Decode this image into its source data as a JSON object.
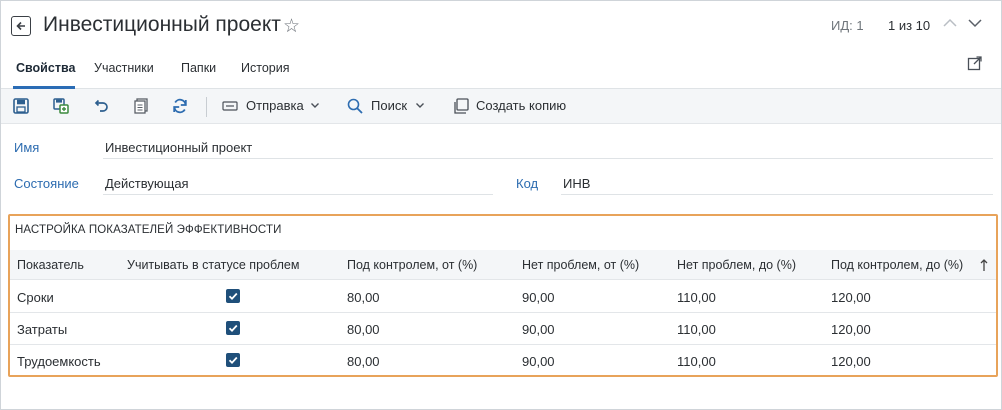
{
  "header": {
    "title": "Инвестиционный проект",
    "id_label": "ИД: 1",
    "pager": "1 из 10"
  },
  "tabs": [
    {
      "label": "Свойства",
      "active": true
    },
    {
      "label": "Участники",
      "active": false
    },
    {
      "label": "Папки",
      "active": false
    },
    {
      "label": "История",
      "active": false
    }
  ],
  "toolbar": {
    "send_label": "Отправка",
    "search_label": "Поиск",
    "copy_label": "Создать копию"
  },
  "fields": {
    "name_label": "Имя",
    "name_value": "Инвестиционный проект",
    "state_label": "Состояние",
    "state_value": "Действующая",
    "code_label": "Код",
    "code_value": "ИНВ"
  },
  "section": {
    "title": "НАСТРОЙКА ПОКАЗАТЕЛЕЙ ЭФФЕКТИВНОСТИ",
    "columns": [
      "Показатель",
      "Учитывать в статусе проблем",
      "Под контролем, от (%)",
      "Нет проблем, от (%)",
      "Нет проблем, до (%)",
      "Под контролем, до (%)"
    ],
    "rows": [
      {
        "name": "Сроки",
        "checked": true,
        "c1": "80,00",
        "c2": "90,00",
        "c3": "110,00",
        "c4": "120,00"
      },
      {
        "name": "Затраты",
        "checked": true,
        "c1": "80,00",
        "c2": "90,00",
        "c3": "110,00",
        "c4": "120,00"
      },
      {
        "name": "Трудоемкость",
        "checked": true,
        "c1": "80,00",
        "c2": "90,00",
        "c3": "110,00",
        "c4": "120,00"
      }
    ]
  },
  "colors": {
    "accent": "#2a6cb5",
    "section_border": "#e8a35a",
    "checkbox": "#1f4f7a"
  },
  "icons": {
    "back": "arrow-left-icon",
    "star": "star-icon",
    "up": "chevron-up-icon",
    "down": "chevron-down-icon",
    "external": "open-external-icon",
    "save": "save-icon",
    "save_close": "save-and-close-icon",
    "undo": "undo-icon",
    "copy_doc": "copy-document-icon",
    "refresh": "refresh-icon",
    "send": "send-icon",
    "search": "search-icon",
    "duplicate": "duplicate-icon",
    "sort": "sort-icon"
  }
}
